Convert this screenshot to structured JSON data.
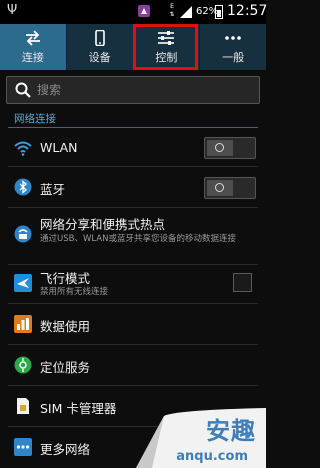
{
  "status_bar": {
    "usb_glyph": "Ψ",
    "network_type_top": "E",
    "network_type_bottom": "⇅",
    "battery_percent": "62%",
    "time": "12:57",
    "icons": [
      "usb-icon",
      "notification-app-icon",
      "signal-icon",
      "battery-icon"
    ]
  },
  "tabs": [
    {
      "label": "连接",
      "icon": "arrows-swap-icon",
      "active": true
    },
    {
      "label": "设备",
      "icon": "phone-device-icon",
      "active": false
    },
    {
      "label": "控制",
      "icon": "sliders-icon",
      "active": false,
      "highlighted": true
    },
    {
      "label": "一般",
      "icon": "more-dots-icon",
      "active": false
    }
  ],
  "search": {
    "placeholder": "搜索"
  },
  "section": {
    "header": "网络连接"
  },
  "items": [
    {
      "title": "WLAN",
      "icon": "wifi-icon",
      "control": "toggle",
      "state": "off"
    },
    {
      "title": "蓝牙",
      "icon": "bluetooth-icon",
      "control": "toggle",
      "state": "off"
    },
    {
      "title": "网络分享和便携式热点",
      "subtitle": "通过USB、WLAN或蓝牙共享您设备的移动数据连接",
      "icon": "hotspot-icon"
    },
    {
      "title": "飞行模式",
      "subtitle": "禁用所有无线连接",
      "icon": "airplane-icon",
      "control": "checkbox",
      "state": "unchecked"
    },
    {
      "title": "数据使用",
      "icon": "data-usage-icon"
    },
    {
      "title": "定位服务",
      "icon": "location-icon"
    },
    {
      "title": "SIM 卡管理器",
      "icon": "sim-card-icon"
    },
    {
      "title": "更多网络",
      "icon": "more-networks-icon"
    }
  ],
  "watermark": {
    "text": "安趣",
    "url": "anqu.com"
  },
  "colors": {
    "active_tab": "#2d6b8c",
    "tab_bar": "#16303f",
    "section_header": "#5aa8d2",
    "highlight": "#e01010",
    "watermark": "#3f7fb8"
  }
}
